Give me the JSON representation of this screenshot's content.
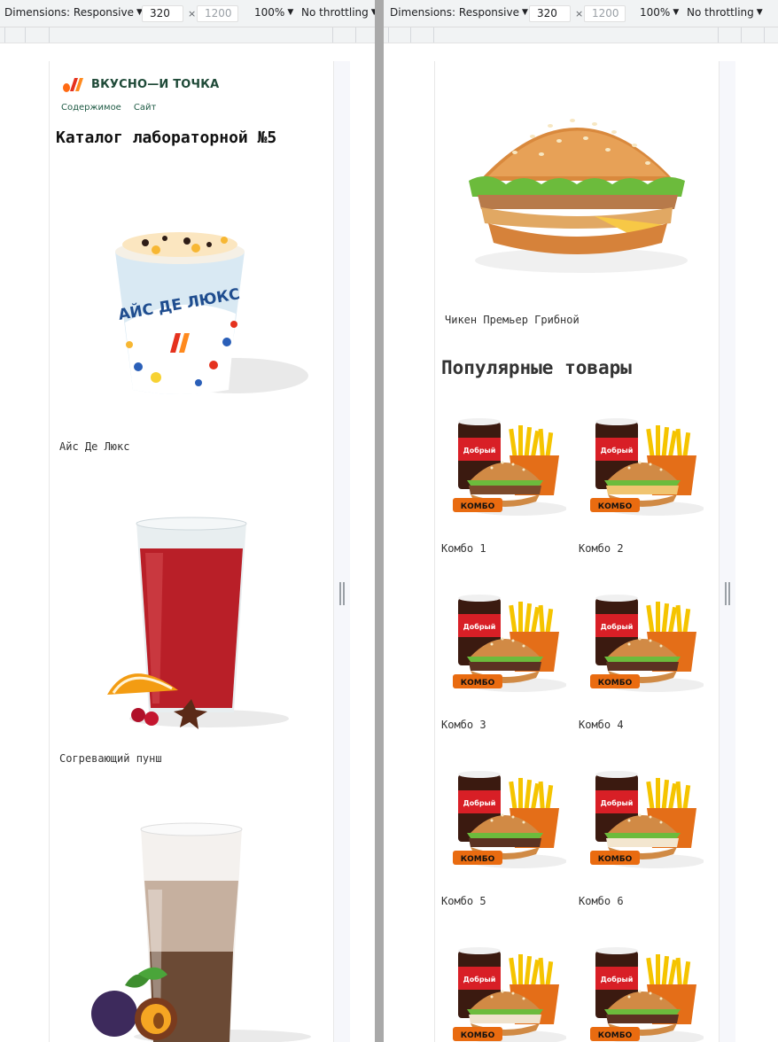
{
  "devtools": {
    "dimensions_label": "Dimensions: Responsive",
    "width": "320",
    "times": "×",
    "height": "1200",
    "zoom": "100%",
    "throttling": "No throttling"
  },
  "site": {
    "logo_text": "ВКУСНО—И ТОЧКА",
    "nav": [
      "Содержимое",
      "Сайт"
    ],
    "catalog_title": "Каталог лабораторной №5",
    "products": [
      "Айс Де Люкс",
      "Согревающий пунш"
    ],
    "featured_product": "Чикен Премьер Грибной",
    "popular_title": "Популярные товары",
    "combos": [
      "Комбо 1",
      "Комбо 2",
      "Комбо 3",
      "Комбо 4",
      "Комбо 5",
      "Комбо 6"
    ],
    "combo_badge": "КОМБО",
    "cup_brand": "Добрый",
    "ice_cup_text": "АЙС ДЕ ЛЮКС"
  },
  "colors": {
    "brand_green": "#1f4a38",
    "brand_orange": "#ff6a13",
    "brand_red": "#e5321e",
    "combo_badge": "#e96b10",
    "devtools_bar": "#f1f3f4"
  },
  "icons": [
    "caret-down-icon",
    "resize-handle-icon",
    "vkusno-logo-icon"
  ]
}
